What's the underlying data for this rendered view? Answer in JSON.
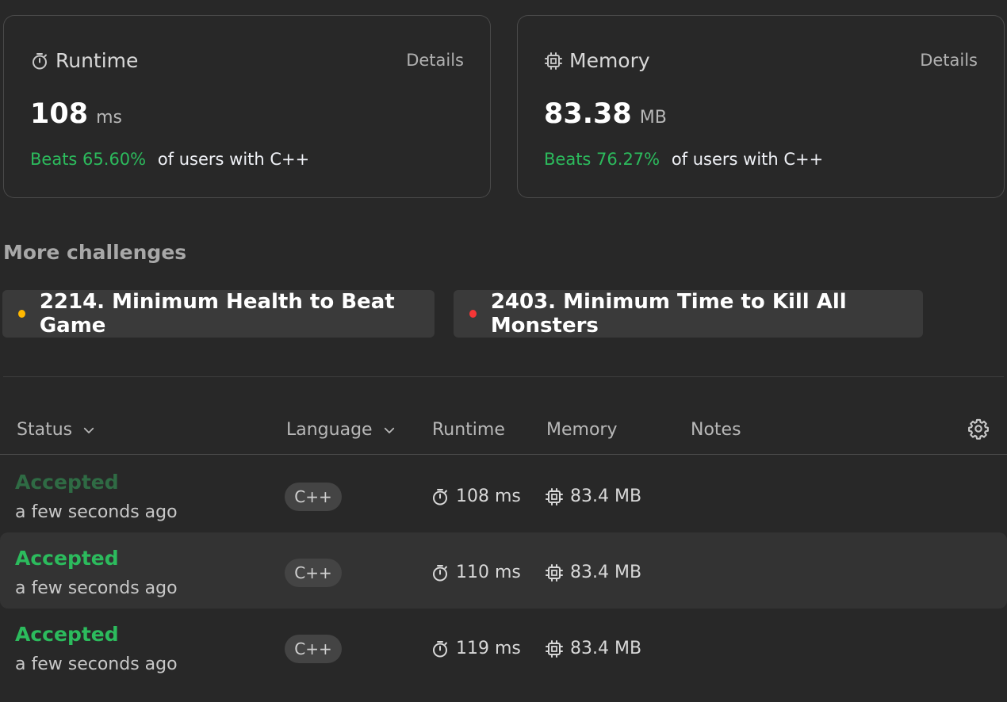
{
  "runtime_card": {
    "title": "Runtime",
    "details_label": "Details",
    "value": "108",
    "unit": "ms",
    "beats": "Beats 65.60%",
    "suffix": "of users with C++"
  },
  "memory_card": {
    "title": "Memory",
    "details_label": "Details",
    "value": "83.38",
    "unit": "MB",
    "beats": "Beats 76.27%",
    "suffix": "of users with C++"
  },
  "challenges": {
    "title": "More challenges",
    "items": [
      {
        "label": "2214. Minimum Health to Beat Game",
        "dot_color": "#ffb800"
      },
      {
        "label": "2403. Minimum Time to Kill All Monsters",
        "dot_color": "#f63636"
      }
    ]
  },
  "table": {
    "headers": {
      "status": "Status",
      "language": "Language",
      "runtime": "Runtime",
      "memory": "Memory",
      "notes": "Notes"
    },
    "rows": [
      {
        "status": "Accepted",
        "when": "a few seconds ago",
        "language": "C++",
        "runtime": "108 ms",
        "memory": "83.4 MB"
      },
      {
        "status": "Accepted",
        "when": "a few seconds ago",
        "language": "C++",
        "runtime": "110 ms",
        "memory": "83.4 MB"
      },
      {
        "status": "Accepted",
        "when": "a few seconds ago",
        "language": "C++",
        "runtime": "119 ms",
        "memory": "83.4 MB"
      }
    ]
  },
  "colors": {
    "accepted": "#2cbb5d",
    "background": "#282828",
    "card_border": "#3d3d3d"
  },
  "icons": {
    "runtime": "stopwatch-icon",
    "memory": "chip-icon",
    "sort": "chevron-down-icon",
    "settings": "gear-icon"
  }
}
